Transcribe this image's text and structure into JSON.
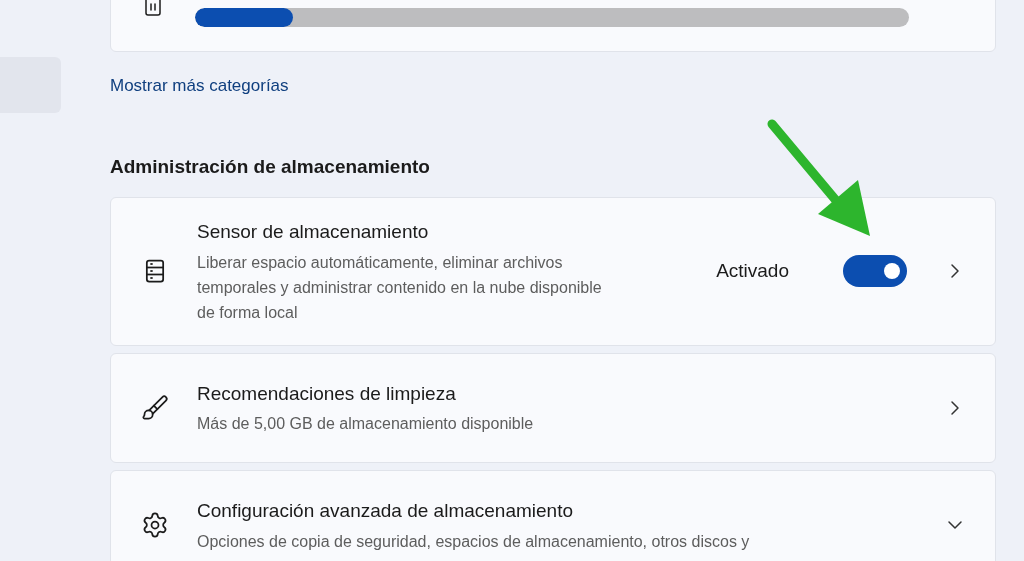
{
  "storage_bar": {
    "level": 0.137
  },
  "show_more_link": "Mostrar más categorías",
  "section_title": "Administración de almacenamiento",
  "cards": [
    {
      "kind": "toggle",
      "title": "Sensor de almacenamiento",
      "description": "Liberar espacio automáticamente, eliminar archivos temporales y administrar contenido en la nube disponible de forma local",
      "status": "Activado",
      "on": true
    },
    {
      "kind": "link",
      "title": "Recomendaciones de limpieza",
      "description": "Más de 5,00 GB de almacenamiento disponible"
    },
    {
      "kind": "expander",
      "title": "Configuración avanzada de almacenamiento",
      "description": "Opciones de copia de seguridad, espacios de almacenamiento, otros discos y"
    }
  ]
}
